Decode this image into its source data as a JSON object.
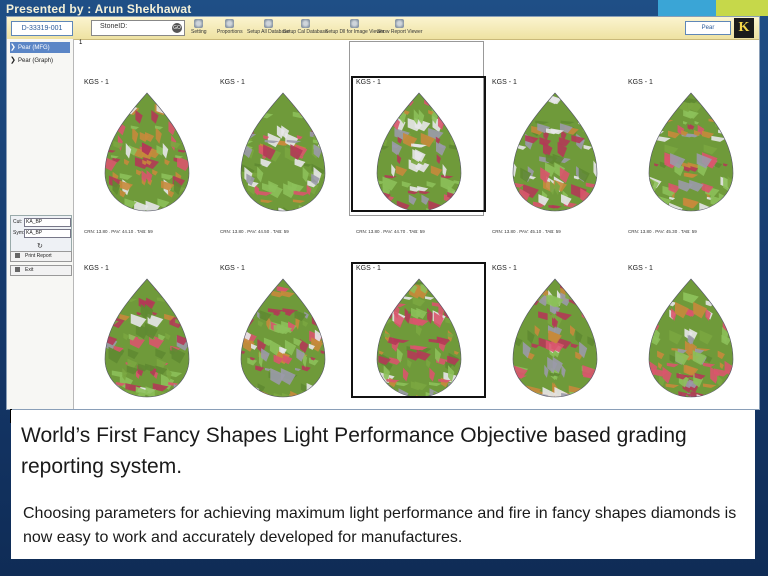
{
  "presenter": "Presented by : Arun Shekhawat",
  "toolbar": {
    "barcode": "D-33319-001",
    "stone_id_label": "StoneID:",
    "go_label": "GO",
    "buttons": [
      "Setting",
      "Proportions",
      "Setup All Database",
      "Setup Cal Database",
      "Setup Dll for Image Viewer",
      "Show Report Viewer"
    ],
    "shape_value": "Pear",
    "logo": "K"
  },
  "sidebar": {
    "items": [
      {
        "label": "Pear (MFG)",
        "active": true
      },
      {
        "label": "Pear (Graph)",
        "active": false
      }
    ],
    "filters": [
      {
        "label": "Cut:",
        "value": "KA_BP"
      },
      {
        "label": "Sym:",
        "value": "KA_BP"
      }
    ],
    "print_label": "Print Report",
    "exit_label": "Exit"
  },
  "grid": {
    "top_marker": "1",
    "cells": [
      {
        "label": "KGS - 1",
        "meas": "CRN: 13.80 . PAV: 44.10 . TAB: 59",
        "selected": false
      },
      {
        "label": "KGS - 1",
        "meas": "CRN: 13.80 . PAV: 44.50 . TAB: 59",
        "selected": false
      },
      {
        "label": "KGS - 1",
        "meas": "CRN: 13.80 . PAV: 44.70 . TAB: 59",
        "selected": true
      },
      {
        "label": "KGS - 1",
        "meas": "CRN: 13.80 . PAV: 45.10 . TAB: 59",
        "selected": false
      },
      {
        "label": "KGS - 1",
        "meas": "CRN: 13.80 . PAV: 45.30 . TAB: 59",
        "selected": false
      },
      {
        "label": "KGS - 1",
        "meas": "CRN: 13.40 . PAV: 44.70 . TAB: 59",
        "selected": false
      },
      {
        "label": "KGS - 1",
        "meas": "CRN: 13.60 . PAV: 44.70 . TAB: 59",
        "selected": false
      },
      {
        "label": "KGS - 1",
        "meas": "CRN: 13.80 . PAV: 44.70 . TAB: 59",
        "selected": true
      },
      {
        "label": "KGS - 1",
        "meas": "CRN: 14.00 . PAV: 44.70 . TAB: 59",
        "selected": false
      },
      {
        "label": "KGS - 1",
        "meas": "CRN: 14.20 . PAV: 44.70 . TAB: 59",
        "selected": false
      }
    ]
  },
  "card": {
    "headline": "World’s First Fancy Shapes Light Performance Objective based grading reporting system.",
    "subtext": "Choosing parameters for achieving maximum light performance and fire in fancy shapes diamonds is now easy to work and accurately developed for manufactures."
  },
  "colors": {
    "background": "#1a4478",
    "sidebar_active": "#5b86c6",
    "toolbar": "#f4eab8",
    "presenter_text": "#f3f0d8",
    "accent_green": "#c6d84a",
    "accent_blue": "#3aa5d6"
  }
}
